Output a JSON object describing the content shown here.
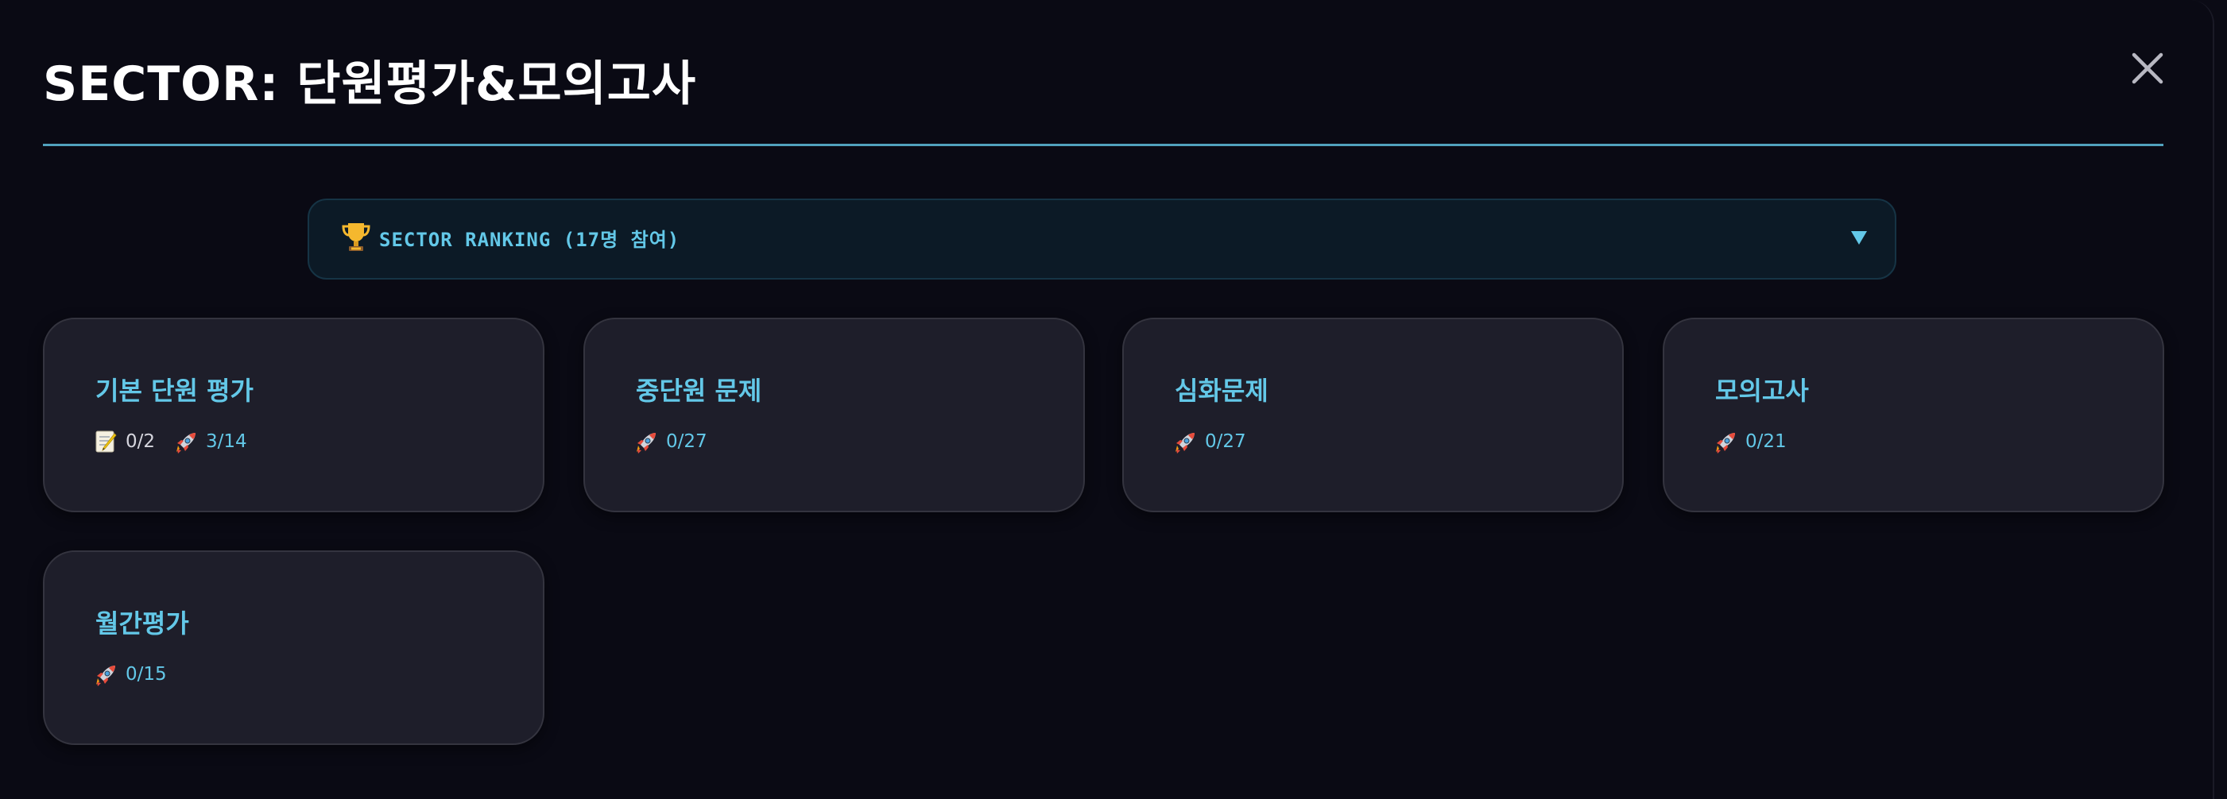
{
  "modal": {
    "title": "SECTOR: 단원평가&모의고사"
  },
  "ranking": {
    "label": "SECTOR RANKING (17명 참여)"
  },
  "cards": [
    {
      "title": "기본 단원 평가",
      "quiz": "0/2",
      "mission": "3/14"
    },
    {
      "title": "중단원 문제",
      "mission": "0/27"
    },
    {
      "title": "심화문제",
      "mission": "0/27"
    },
    {
      "title": "모의고사",
      "mission": "0/21"
    },
    {
      "title": "월간평가",
      "mission": "0/15"
    }
  ],
  "icons": {
    "close": "close-icon",
    "trophy": "trophy-icon",
    "chevron": "chevron-down-icon",
    "memo": "memo-icon",
    "rocket": "rocket-icon"
  },
  "colors": {
    "background": "#0a0a14",
    "accent": "#63c8e8",
    "card": "#1e1e2a",
    "card_border": "#34343f",
    "ranking_bg": "#0c1a26"
  }
}
